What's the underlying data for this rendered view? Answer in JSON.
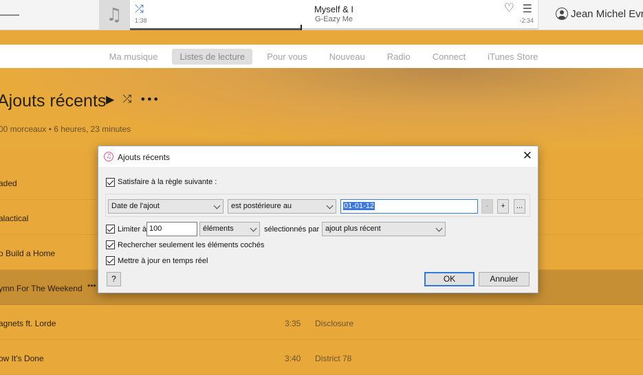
{
  "player": {
    "song_title": "Myself & I",
    "artist": "G-Eazy Me",
    "elapsed": "1:38",
    "remaining": "-2:34",
    "progress": 0.42,
    "user_name": "Jean Michel Evra",
    "shuffle_icon": "shuffle-icon",
    "heart_icon": "heart-icon",
    "upnext_icon": "up-next-list-icon"
  },
  "nav": {
    "tabs": [
      {
        "label": "Ma musique"
      },
      {
        "label": "Listes de lecture"
      },
      {
        "label": "Pour vous"
      },
      {
        "label": "Nouveau"
      },
      {
        "label": "Radio"
      },
      {
        "label": "Connect"
      },
      {
        "label": "iTunes Store"
      }
    ],
    "active_index": 1
  },
  "playlist": {
    "title": "Ajouts récents",
    "summary": "00 morceaux • 6 heures, 23 minutes",
    "tracks": [
      {
        "name": "aded",
        "time": "",
        "artist": ""
      },
      {
        "name": "alactical",
        "time": "",
        "artist": ""
      },
      {
        "name": "o Build a Home",
        "time": "",
        "artist": ""
      },
      {
        "name": "ymn For The Weekend",
        "time": "",
        "artist": "",
        "more": "•••"
      },
      {
        "name": "agnets ft. Lorde",
        "time": "3:35",
        "artist": "Disclosure"
      },
      {
        "name": "ow It's Done",
        "time": "3:40",
        "artist": "District 78"
      }
    ]
  },
  "dialog": {
    "title": "Ajouts récents",
    "match_rule_label": "Satisfaire à la règle suivante :",
    "rule": {
      "field": "Date de l'ajout",
      "operator": "est postérieure au",
      "value": "01-01-12",
      "minus": "-",
      "plus": "+",
      "more": "..."
    },
    "limit_label": "Limiter à",
    "limit_value": "100",
    "limit_unit": "éléments",
    "selected_by_label": "sélectionnés par",
    "selected_by": "ajout plus récent",
    "only_checked_label": "Rechercher seulement les éléments cochés",
    "live_update_label": "Mettre à jour en temps réel",
    "help": "?",
    "ok": "OK",
    "cancel": "Annuler"
  }
}
